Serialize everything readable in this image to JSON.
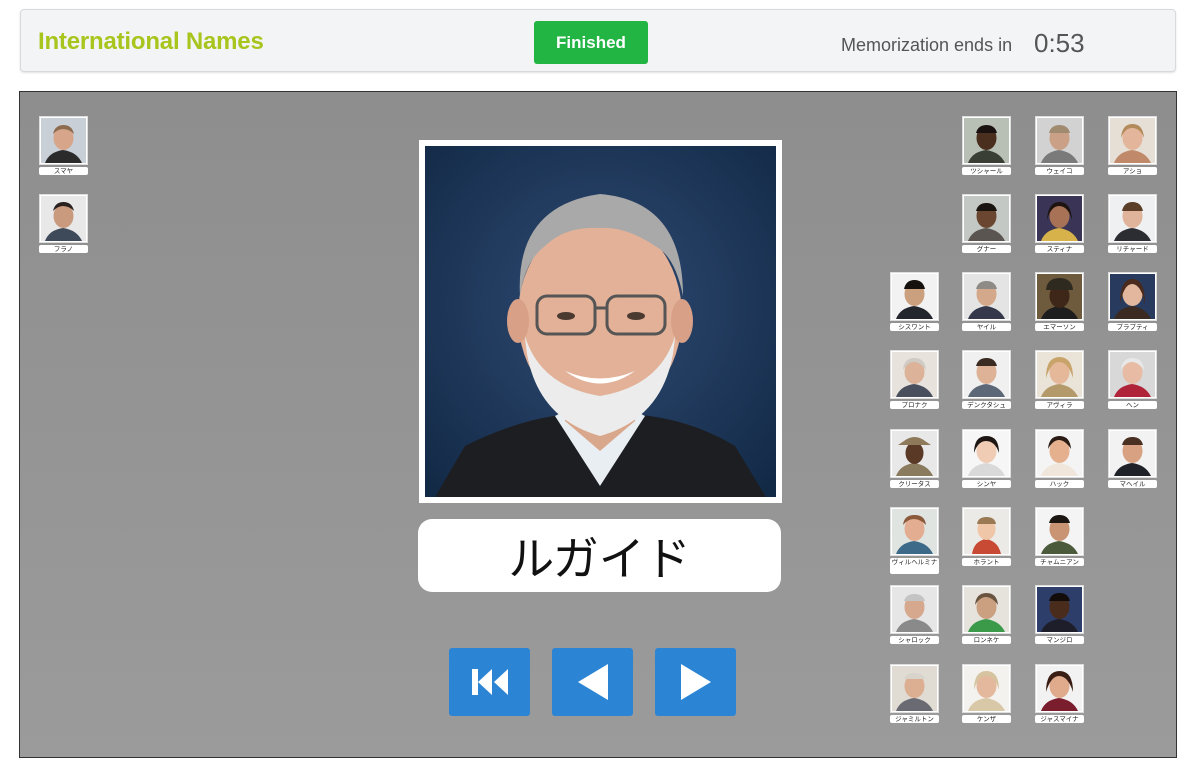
{
  "header": {
    "title": "International Names",
    "finished_label": "Finished",
    "timer_label": "Memorization ends in",
    "timer_value": "0:53"
  },
  "current": {
    "name": "ルガイド"
  },
  "nav": {
    "first_icon": "skip-to-first-icon",
    "prev_icon": "previous-arrow-icon",
    "next_icon": "next-arrow-icon"
  },
  "colors": {
    "title": "#a7c51d",
    "finished_button": "#22b543",
    "nav_button": "#2b85d4",
    "stage_background": "#959595"
  },
  "thumbnails": [
    {
      "label": "スマヤ"
    },
    {
      "label": "フラノ"
    },
    {
      "label": "ツシャール"
    },
    {
      "label": "ウェイコ"
    },
    {
      "label": "アショ"
    },
    {
      "label": "グナー"
    },
    {
      "label": "スティナ"
    },
    {
      "label": "リチャード"
    },
    {
      "label": "シスワント"
    },
    {
      "label": "ヤイル"
    },
    {
      "label": "エマーソン"
    },
    {
      "label": "プラプティ"
    },
    {
      "label": "プロナク"
    },
    {
      "label": "デンクタシュ"
    },
    {
      "label": "アヴィラ"
    },
    {
      "label": "ヘン"
    },
    {
      "label": "クリータス"
    },
    {
      "label": "シンヤ"
    },
    {
      "label": "ハック"
    },
    {
      "label": "マヘイル"
    },
    {
      "label": "ヴィルヘルミナ"
    },
    {
      "label": "ホラント"
    },
    {
      "label": "チャムニアン"
    },
    {
      "label": "シャロック"
    },
    {
      "label": "ロンネケ"
    },
    {
      "label": "マンジロ"
    },
    {
      "label": "ジャミルトン"
    },
    {
      "label": "ケンザ"
    },
    {
      "label": "ジャスマイナ"
    }
  ]
}
